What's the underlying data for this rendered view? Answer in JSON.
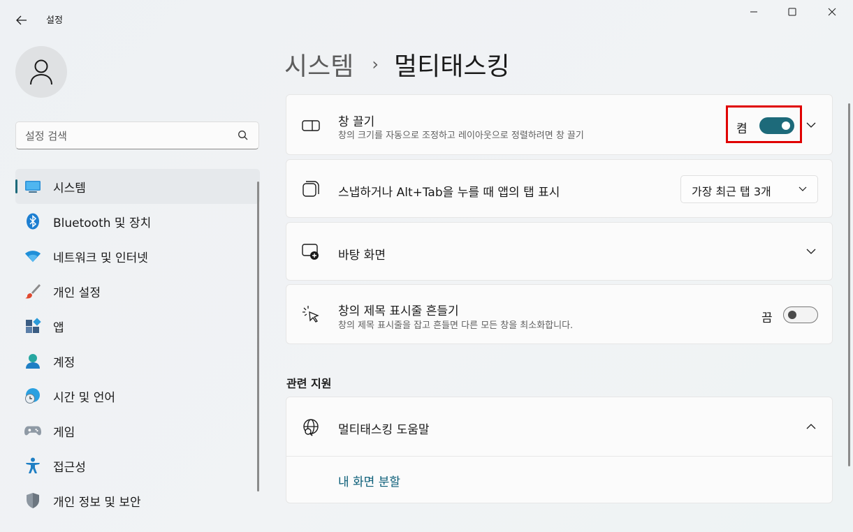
{
  "window": {
    "app_title": "설정"
  },
  "sidebar": {
    "search_placeholder": "설정 검색",
    "items": [
      {
        "label": "시스템",
        "icon": "monitor-icon",
        "active": true
      },
      {
        "label": "Bluetooth 및 장치",
        "icon": "bluetooth-icon"
      },
      {
        "label": "네트워크 및 인터넷",
        "icon": "wifi-icon"
      },
      {
        "label": "개인 설정",
        "icon": "brush-icon"
      },
      {
        "label": "앱",
        "icon": "apps-icon"
      },
      {
        "label": "계정",
        "icon": "person-icon"
      },
      {
        "label": "시간 및 언어",
        "icon": "globe-clock-icon"
      },
      {
        "label": "게임",
        "icon": "gamepad-icon"
      },
      {
        "label": "접근성",
        "icon": "accessibility-icon"
      },
      {
        "label": "개인 정보 및 보안",
        "icon": "shield-icon"
      }
    ]
  },
  "breadcrumb": {
    "parent": "시스템",
    "separator": "›",
    "current": "멀티태스킹"
  },
  "settings": {
    "snap": {
      "title": "창 끌기",
      "subtitle": "창의 크기를 자동으로 조정하고 레이아웃으로 정렬하려면 창 끌기",
      "state_label": "켬",
      "on": true
    },
    "alt_tab": {
      "title": "스냅하거나 Alt+Tab을 누를 때 앱의 탭 표시",
      "dropdown_value": "가장 최근 탭 3개"
    },
    "desktops": {
      "title": "바탕 화면"
    },
    "shake": {
      "title": "창의 제목 표시줄 흔들기",
      "subtitle": "창의 제목 표시줄을 잡고 흔들면 다른 모든 창을 최소화합니다.",
      "state_label": "끔",
      "on": false
    }
  },
  "related": {
    "section_title": "관련 지원",
    "help_title": "멀티태스킹 도움말",
    "link": "내 화면 분할"
  },
  "colors": {
    "accent": "#1d6a7a",
    "highlight": "#e00000",
    "link": "#0b5e78"
  }
}
